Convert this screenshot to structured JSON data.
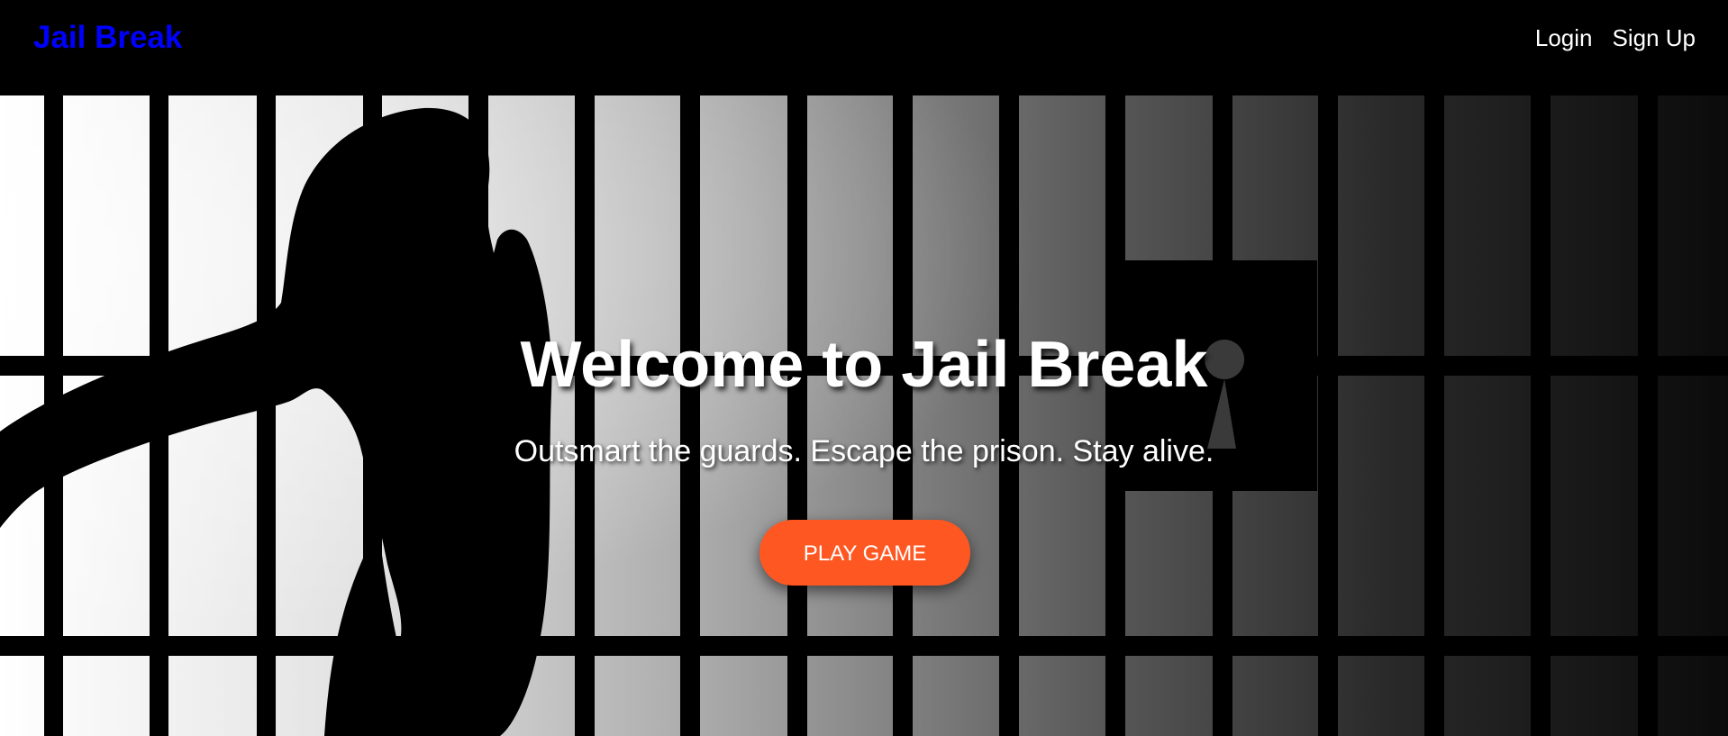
{
  "header": {
    "brand": "Jail Break",
    "links": [
      {
        "label": "Login"
      },
      {
        "label": "Sign Up"
      }
    ]
  },
  "hero": {
    "title": "Welcome to Jail Break",
    "subtitle": "Outsmart the guards. Escape the prison. Stay alive.",
    "cta_label": "PLAY GAME",
    "background_icon": "prisoner-behind-bars-silhouette",
    "keyhole_icon": "keyhole-icon"
  },
  "colors": {
    "brand": "#0000ff",
    "cta": "#ff5722",
    "nav_background": "#000000",
    "text": "#ffffff"
  }
}
